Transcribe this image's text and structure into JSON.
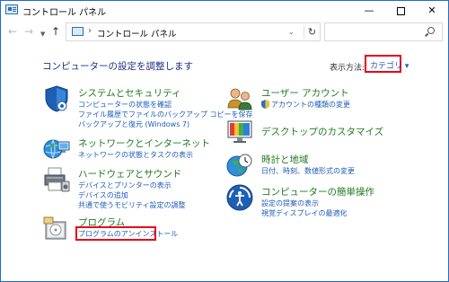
{
  "window": {
    "title": "コントロール パネル",
    "minimize_glyph": "—",
    "close_glyph": "✕"
  },
  "nav": {
    "back_glyph": "←",
    "forward_glyph": "→",
    "recent_glyph": "▼",
    "up_glyph": "↑",
    "breadcrumb_separator": "›",
    "breadcrumb": "コントロール パネル",
    "address_dropdown_glyph": "⌄",
    "refresh_glyph": "↻",
    "search_placeholder": ""
  },
  "main": {
    "title": "コンピューターの設定を調整します",
    "view_by_label": "表示方法:",
    "view_by_value": "カテゴリ ▾"
  },
  "categories_left": [
    {
      "title": "システムとセキュリティ",
      "links": [
        "コンピューターの状態を確認",
        "ファイル履歴でファイルのバックアップ コピーを保存",
        "バックアップと復元 (Windows 7)"
      ]
    },
    {
      "title": "ネットワークとインターネット",
      "links": [
        "ネットワークの状態とタスクの表示"
      ]
    },
    {
      "title": "ハードウェアとサウンド",
      "links": [
        "デバイスとプリンターの表示",
        "デバイスの追加",
        "共通で使うモビリティ設定の調整"
      ]
    },
    {
      "title": "プログラム",
      "links": [
        "プログラムのアンインストール"
      ]
    }
  ],
  "categories_right": [
    {
      "title": "ユーザー アカウント",
      "links": [
        "アカウントの種類の変更"
      ]
    },
    {
      "title": "デスクトップのカスタマイズ",
      "links": []
    },
    {
      "title": "時計と地域",
      "links": [
        "日付、時刻、数値形式の変更"
      ]
    },
    {
      "title": "コンピューターの簡単操作",
      "links": [
        "設定の提案の表示",
        "視覚ディスプレイの最適化"
      ]
    }
  ],
  "colors": {
    "category_title": "#1f7a1f",
    "link": "#1e5bb8",
    "heading": "#1e3287",
    "highlight": "#e8001c",
    "window_border": "#1e6ec8"
  }
}
